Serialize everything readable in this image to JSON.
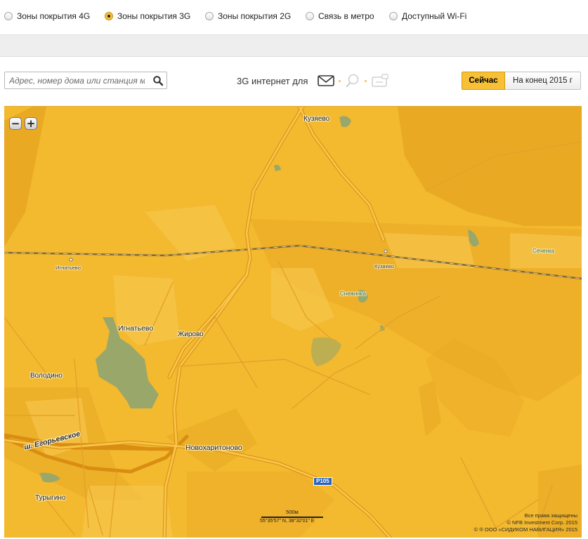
{
  "coverage_tabs": [
    {
      "label": "Зоны покрытия 4G",
      "selected": false
    },
    {
      "label": "Зоны покрытия 3G",
      "selected": true
    },
    {
      "label": "Зоны покрытия 2G",
      "selected": false
    },
    {
      "label": "Связь в метро",
      "selected": false
    },
    {
      "label": "Доступный Wi-Fi",
      "selected": false
    }
  ],
  "search": {
    "placeholder": "Адрес, номер дома или станция м",
    "icon": "search-icon"
  },
  "promo": {
    "label": "3G интернет для",
    "icons": [
      "mail-icon",
      "search-icon",
      "tv-icon"
    ]
  },
  "time_toggle": {
    "now": "Сейчас",
    "end_2015": "На конец 2015 г",
    "active": "now"
  },
  "map": {
    "zoom_out": "−",
    "zoom_in": "+",
    "places": {
      "kuzyaevo_top": "Кузяево",
      "ignatyevo_station": "Игнатьево",
      "kuzyaevo_station": "Кузяево",
      "sechenka": "Сеченка",
      "snezhinka": "Снежинка",
      "ignatyevo": "Игнатьево",
      "zhirovo": "Жирово",
      "volodino": "Володино",
      "novokharitonovo": "Новохаритоново",
      "egoryevskoe": "ш. Егорьевское",
      "turygino": "Турыгино"
    },
    "route": "Р105",
    "scale_label": "500м",
    "coordinates": "55°35'57\" N, 38°32'01\" E",
    "copyright": [
      "Все права защищены",
      "© NFB Investment Corp. 2015",
      "© ® ООО «СИДИКОМ НАВИГАЦИЯ» 2015"
    ],
    "colors": {
      "coverage": "#f3b92f",
      "coverage_dark": "#e8a823",
      "road": "#f8c548",
      "water": "#9aa76a"
    }
  }
}
